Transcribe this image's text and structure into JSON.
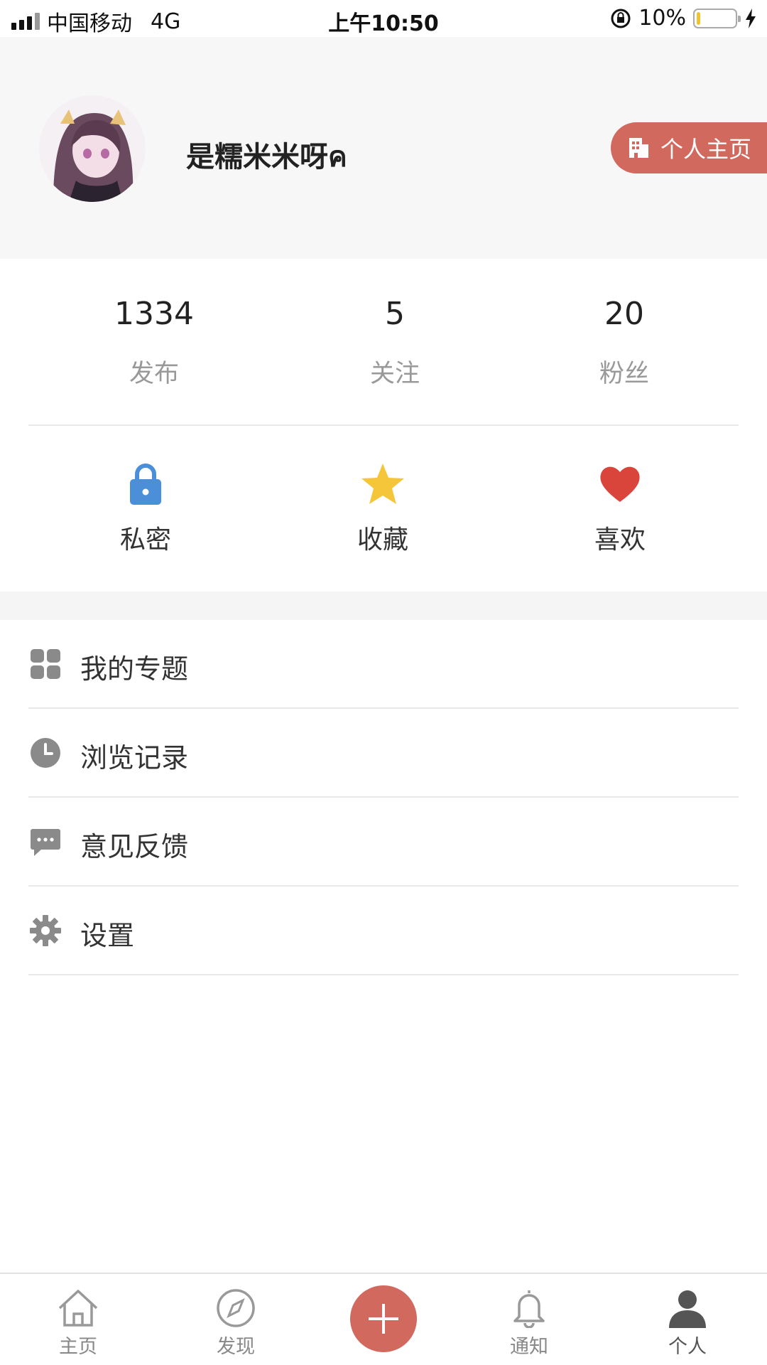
{
  "status_bar": {
    "carrier": "中国移动",
    "network": "4G",
    "time": "上午10:50",
    "battery_percent": "10%",
    "battery_level": 0.1
  },
  "profile": {
    "username": "是糯米米呀ค",
    "home_button_label": "个人主页",
    "accent_color": "#d2695f"
  },
  "stats": [
    {
      "value": "1334",
      "label": "发布"
    },
    {
      "value": "5",
      "label": "关注"
    },
    {
      "value": "20",
      "label": "粉丝"
    }
  ],
  "shortcuts": [
    {
      "label": "私密",
      "icon": "lock-icon",
      "color": "#4a8fd8"
    },
    {
      "label": "收藏",
      "icon": "star-icon",
      "color": "#f5c53a"
    },
    {
      "label": "喜欢",
      "icon": "heart-icon",
      "color": "#d9453b"
    }
  ],
  "menu": [
    {
      "label": "我的专题",
      "icon": "grid-icon"
    },
    {
      "label": "浏览记录",
      "icon": "clock-icon"
    },
    {
      "label": "意见反馈",
      "icon": "chat-icon"
    },
    {
      "label": "设置",
      "icon": "gear-icon"
    }
  ],
  "tabbar": {
    "home": "主页",
    "discover": "发现",
    "notify": "通知",
    "me": "个人",
    "active": "个人"
  }
}
